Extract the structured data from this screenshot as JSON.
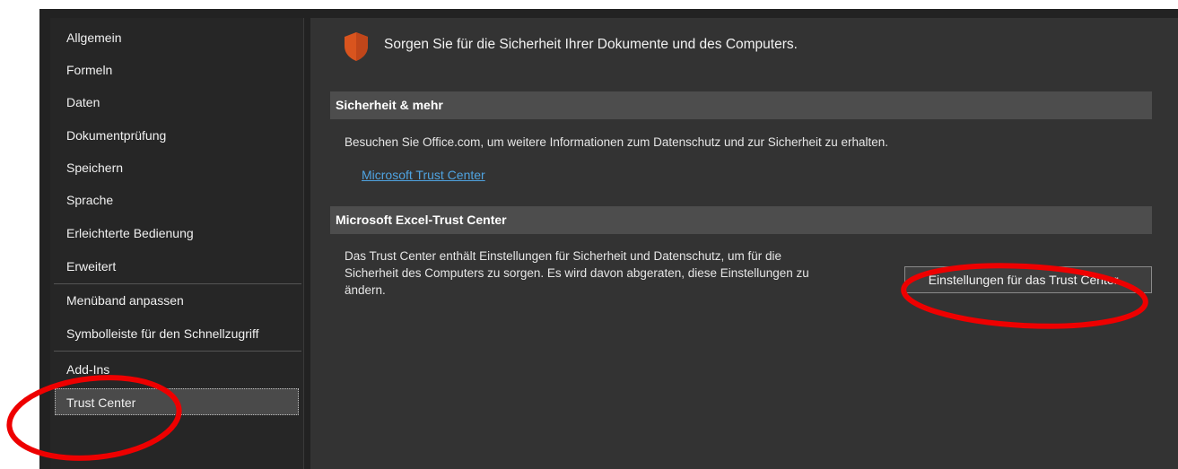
{
  "sidebar": {
    "items": [
      {
        "label": "Allgemein"
      },
      {
        "label": "Formeln"
      },
      {
        "label": "Daten"
      },
      {
        "label": "Dokumentprüfung"
      },
      {
        "label": "Speichern"
      },
      {
        "label": "Sprache"
      },
      {
        "label": "Erleichterte Bedienung"
      },
      {
        "label": "Erweitert"
      },
      {
        "label": "Menüband anpassen"
      },
      {
        "label": "Symbolleiste für den Schnellzugriff"
      },
      {
        "label": "Add-Ins"
      },
      {
        "label": "Trust Center",
        "selected": true
      }
    ]
  },
  "main": {
    "headline": "Sorgen Sie für die Sicherheit Ihrer Dokumente und des Computers.",
    "icon": "shield-icon",
    "sections": [
      {
        "header": "Sicherheit & mehr",
        "text": "Besuchen Sie Office.com, um weitere Informationen zum Datenschutz und zur Sicherheit zu erhalten.",
        "link": "Microsoft Trust Center"
      },
      {
        "header": "Microsoft Excel-Trust Center",
        "text_lines": [
          "Das Trust Center enthält Einstellungen für Sicherheit und Datenschutz, um für die",
          "Sicherheit des Computers zu sorgen. Es wird davon abgeraten, diese Einstellungen zu",
          "ändern."
        ],
        "button": "Einstellungen für das Trust Center..."
      }
    ]
  },
  "colors": {
    "background": "#333333",
    "sidebar": "#262626",
    "section_header": "#4d4d4d",
    "link": "#4fa3e0",
    "shield": "#d9541e",
    "annotation": "#ee0000"
  }
}
